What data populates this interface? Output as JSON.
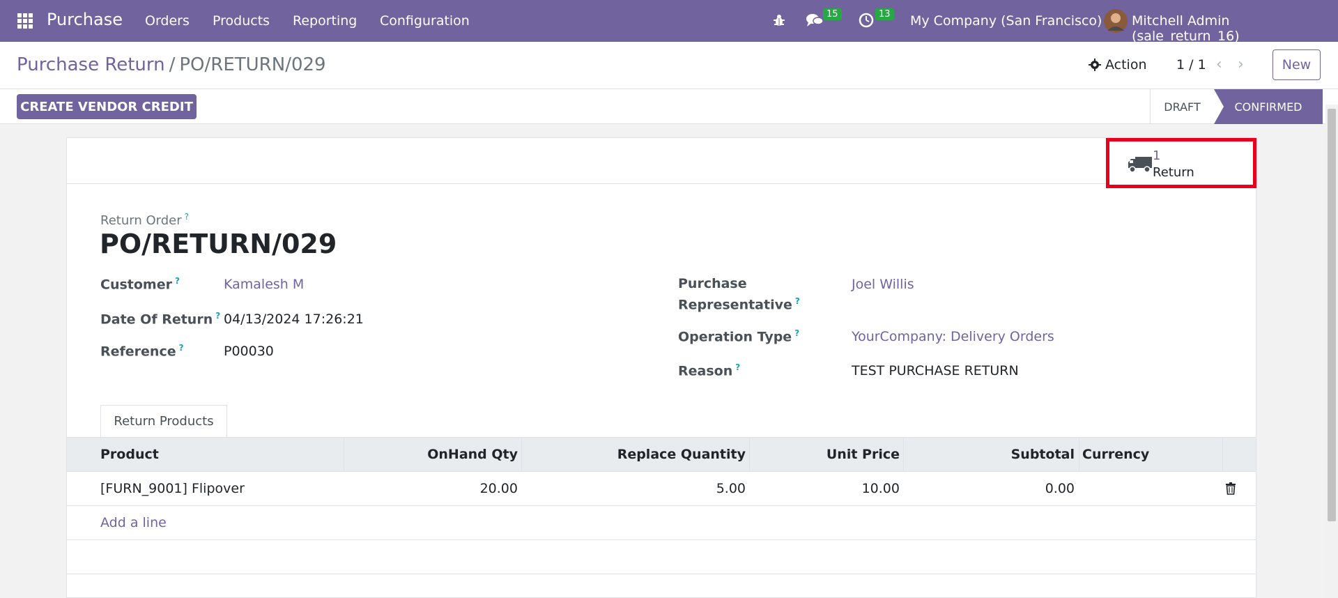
{
  "navbar": {
    "app_name": "Purchase",
    "menu": [
      "Orders",
      "Products",
      "Reporting",
      "Configuration"
    ],
    "chat_count": "15",
    "activity_count": "13",
    "company": "My Company (San Francisco)",
    "user": "Mitchell Admin (sale_return_16)"
  },
  "breadcrumb": {
    "parent": "Purchase Return",
    "separator": "/",
    "current": "PO/RETURN/029"
  },
  "controls": {
    "action_label": "Action",
    "pager": "1 / 1",
    "new_label": "New"
  },
  "statusbar": {
    "vendor_credit_label": "CREATE VENDOR CREDIT",
    "stages": [
      "DRAFT",
      "CONFIRMED"
    ],
    "active_stage": "CONFIRMED"
  },
  "smart_button": {
    "value": "1",
    "label": "Return"
  },
  "form": {
    "return_order_label": "Return Order",
    "title": "PO/RETURN/029",
    "customer_label": "Customer",
    "customer_value": "Kamalesh M",
    "date_label": "Date Of Return",
    "date_value": "04/13/2024 17:26:21",
    "reference_label": "Reference",
    "reference_value": "P00030",
    "rep_label_1": "Purchase",
    "rep_label_2": "Representative",
    "rep_value": "Joel Willis",
    "operation_label": "Operation Type",
    "operation_value": "YourCompany: Delivery Orders",
    "reason_label": "Reason",
    "reason_value": "TEST PURCHASE RETURN",
    "help_mark": "?"
  },
  "tabs": {
    "return_products": "Return Products"
  },
  "table": {
    "headers": [
      "Product",
      "OnHand Qty",
      "Replace Quantity",
      "Unit Price",
      "Subtotal",
      "Currency"
    ],
    "rows": [
      {
        "product": "[FURN_9001] Flipover",
        "onhand": "20.00",
        "replace_qty": "5.00",
        "unit_price": "10.00",
        "subtotal": "0.00",
        "currency": ""
      }
    ],
    "add_line": "Add a line"
  },
  "colors": {
    "brand": "#71639e",
    "highlight": "#e8001c",
    "badge": "#28a745"
  }
}
